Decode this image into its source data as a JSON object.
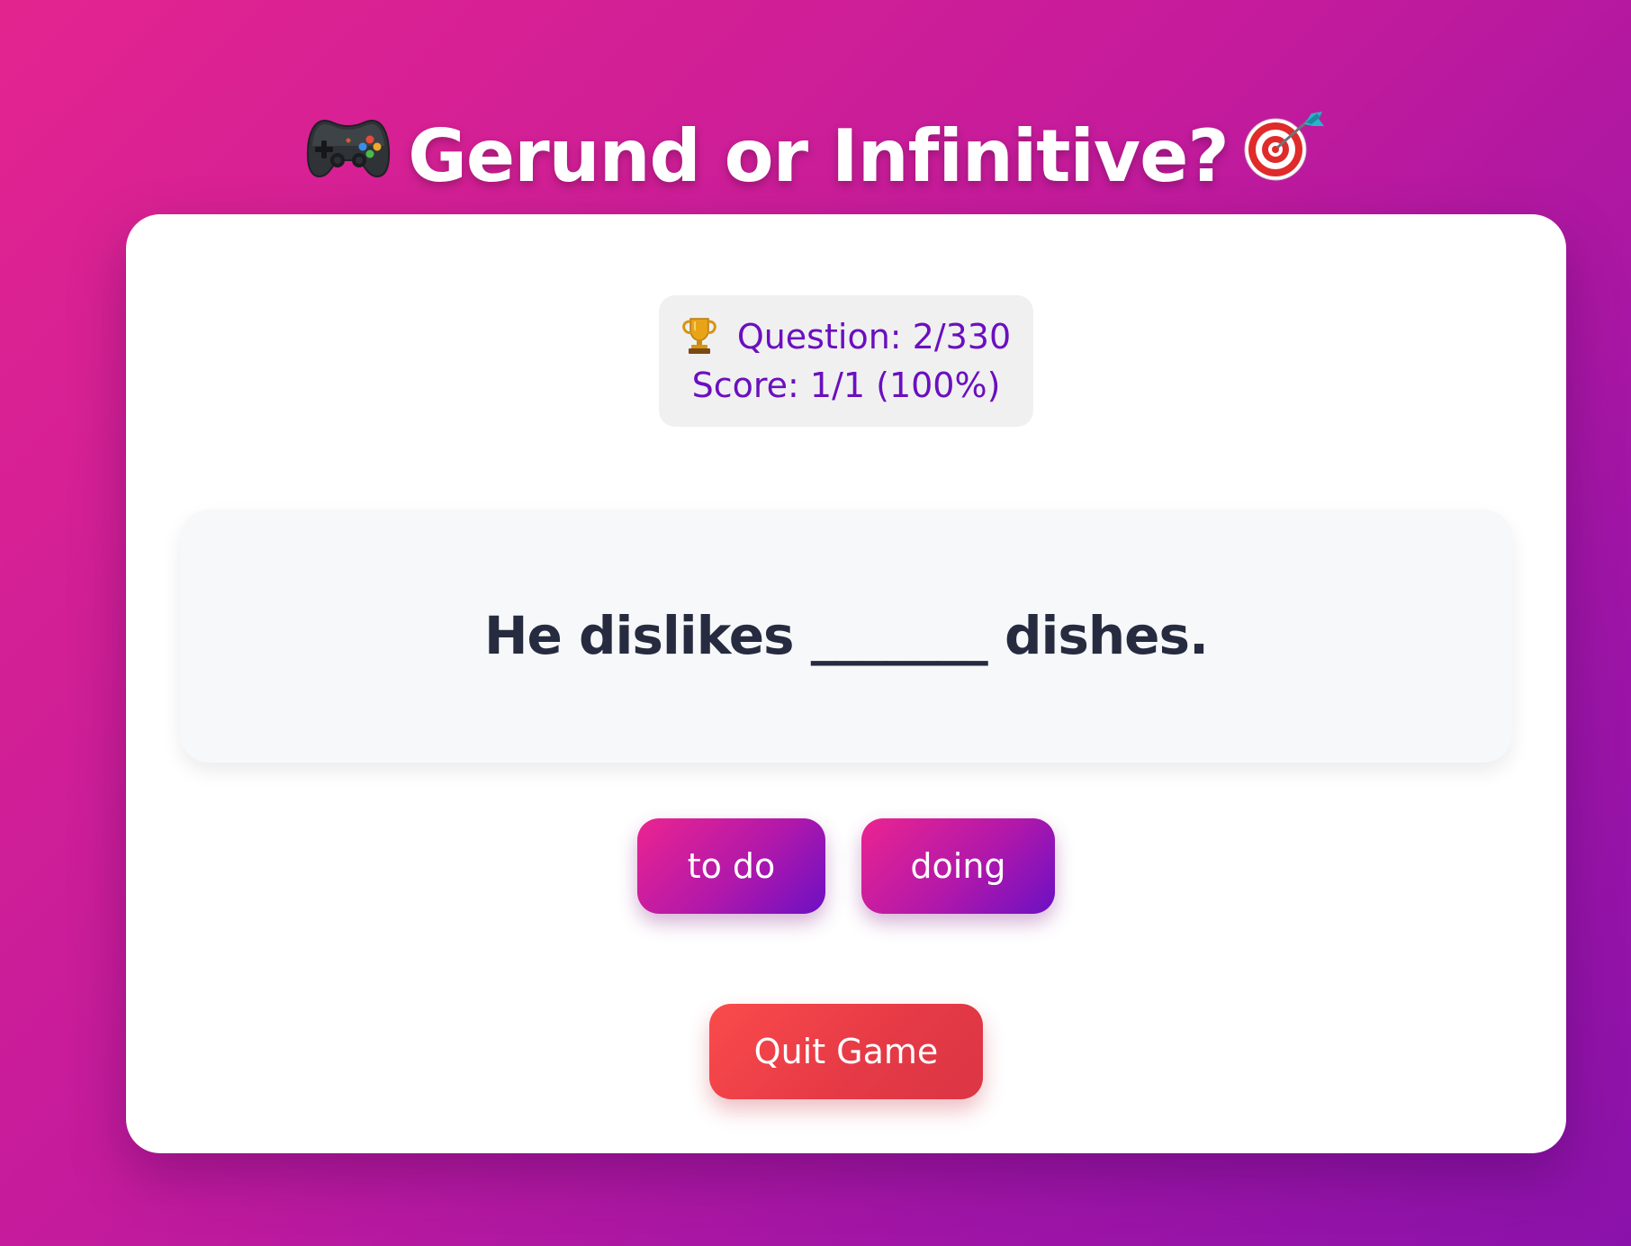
{
  "header": {
    "title": "Gerund or Infinitive?",
    "left_icon": "game-controller-icon",
    "right_icon": "target-dart-icon"
  },
  "status": {
    "icon": "trophy-icon",
    "question_label": "Question: 2/330",
    "score_label": "Score: 1/1 (100%)",
    "current_question": 2,
    "total_questions": 330,
    "correct_answers": 1,
    "answered": 1,
    "score_percent": 100
  },
  "question": {
    "sentence": "He dislikes _______ dishes."
  },
  "answers": [
    {
      "label": "to do"
    },
    {
      "label": "doing"
    }
  ],
  "actions": {
    "quit_label": "Quit Game"
  },
  "colors": {
    "background_start": "#e3248f",
    "background_end": "#8a12aa",
    "status_text": "#6b0fbf",
    "question_text": "#262b40",
    "answer_gradient_start": "#ec2490",
    "answer_gradient_end": "#6c10c4",
    "quit_button": "#f04545"
  }
}
